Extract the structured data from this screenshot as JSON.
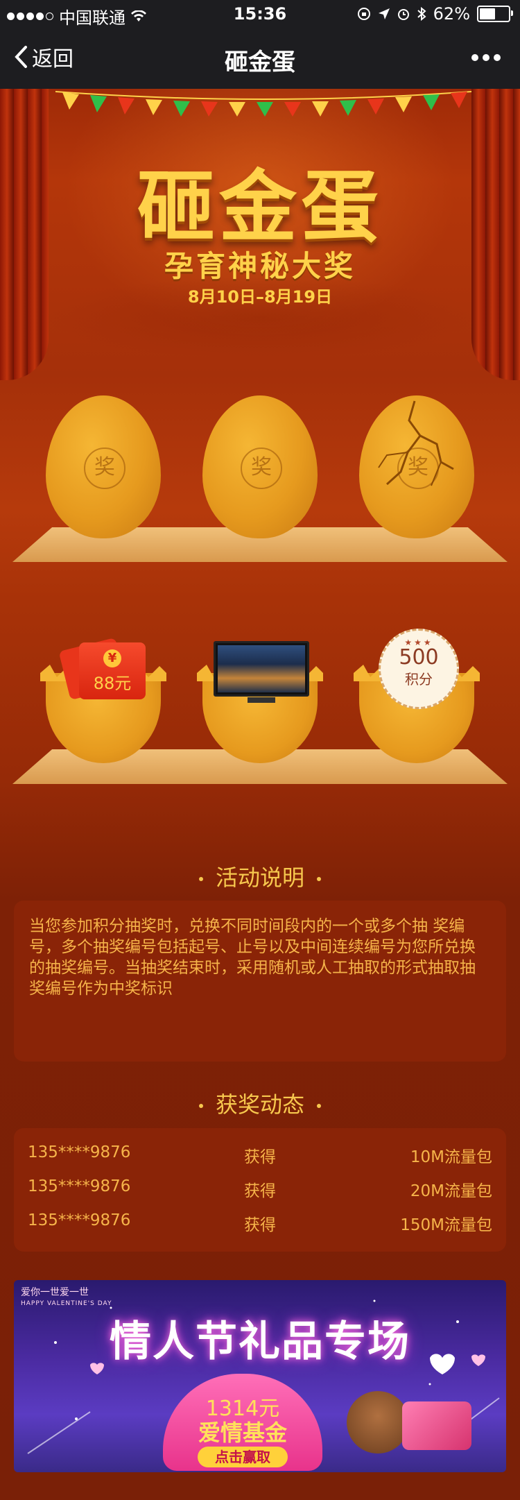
{
  "status_bar": {
    "carrier": "中国联通",
    "time": "15:36",
    "battery": "62%",
    "battery_level": 0.62
  },
  "nav": {
    "back_label": "返回",
    "title": "砸金蛋"
  },
  "banner": {
    "title": "砸金蛋",
    "subtitle": "孕育神秘大奖",
    "date_range": "8月10日–8月19日"
  },
  "eggs": [
    {
      "mark": "奖",
      "state": "intact"
    },
    {
      "mark": "奖",
      "state": "intact"
    },
    {
      "mark": "奖",
      "state": "cracked"
    }
  ],
  "prizes": [
    {
      "type": "red-envelope",
      "coin": "¥",
      "amount": "88元"
    },
    {
      "type": "tv"
    },
    {
      "type": "points",
      "stars": "★★★",
      "value": "500",
      "unit": "积分"
    }
  ],
  "rules": {
    "title": "活动说明",
    "text": "当您参加积分抽奖时，兑换不同时间段内的一个或多个抽 奖编号，多个抽奖编号包括起号、止号以及中间连续编号为您所兑换的抽奖编号。当抽奖结束时，采用随机或人工抽取的形式抽取抽奖编号作为中奖标识"
  },
  "winners": {
    "title": "获奖动态",
    "rows": [
      {
        "phone": "135****9876",
        "verb": "获得",
        "prize": "10M流量包"
      },
      {
        "phone": "135****9876",
        "verb": "获得",
        "prize": "20M流量包"
      },
      {
        "phone": "135****9876",
        "verb": "获得",
        "prize": "150M流量包"
      }
    ]
  },
  "ad": {
    "corner_cn": "爱你一世爱一世",
    "corner_en": "HAPPY VALENTINE'S DAY",
    "title": "情人节礼品专场",
    "amount": "1314元",
    "fund": "爱情基金",
    "button": "点击赢取"
  },
  "colors": {
    "gold": "#f7c84e",
    "text_orange": "#f6b44a",
    "card_bg": "#8a2407",
    "nav_bg": "#1d1d20"
  }
}
